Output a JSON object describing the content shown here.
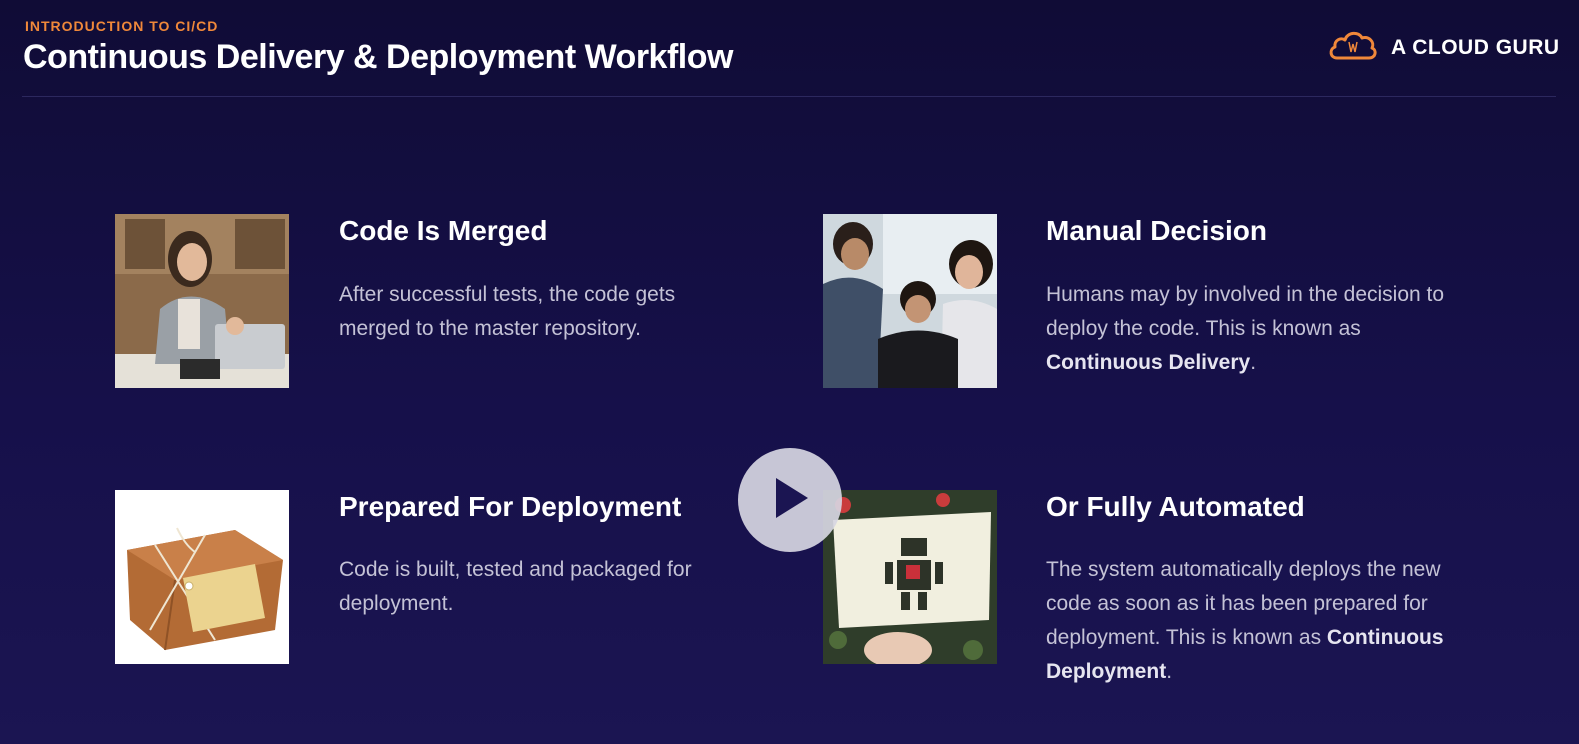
{
  "header": {
    "kicker": "INTRODUCTION TO CI/CD",
    "title": "Continuous Delivery & Deployment Workflow",
    "brand": "A CLOUD GURU",
    "brand_color": "#f0883a"
  },
  "cards": [
    {
      "title": "Code Is Merged",
      "body": "After successful tests, the code gets merged to the master repository.",
      "image": "woman-celebrating-at-laptop"
    },
    {
      "title": "Manual Decision",
      "body_pre": "Humans may by involved in the decision to deploy the code. This is known as ",
      "body_bold": "Continuous Delivery",
      "body_post": ".",
      "image": "team-looking-at-screen"
    },
    {
      "title": "Prepared For Deployment",
      "body": "Code is built, tested and packaged for deployment.",
      "image": "wrapped-package-with-tag"
    },
    {
      "title": "Or Fully Automated",
      "body_pre": "The system automatically deploys the new code as soon as it has been prepared for deployment. This is known as ",
      "body_bold": "Continuous Deployment",
      "body_post": ".",
      "image": "robot-card-in-hand"
    }
  ],
  "player": {
    "icon": "play-icon"
  }
}
